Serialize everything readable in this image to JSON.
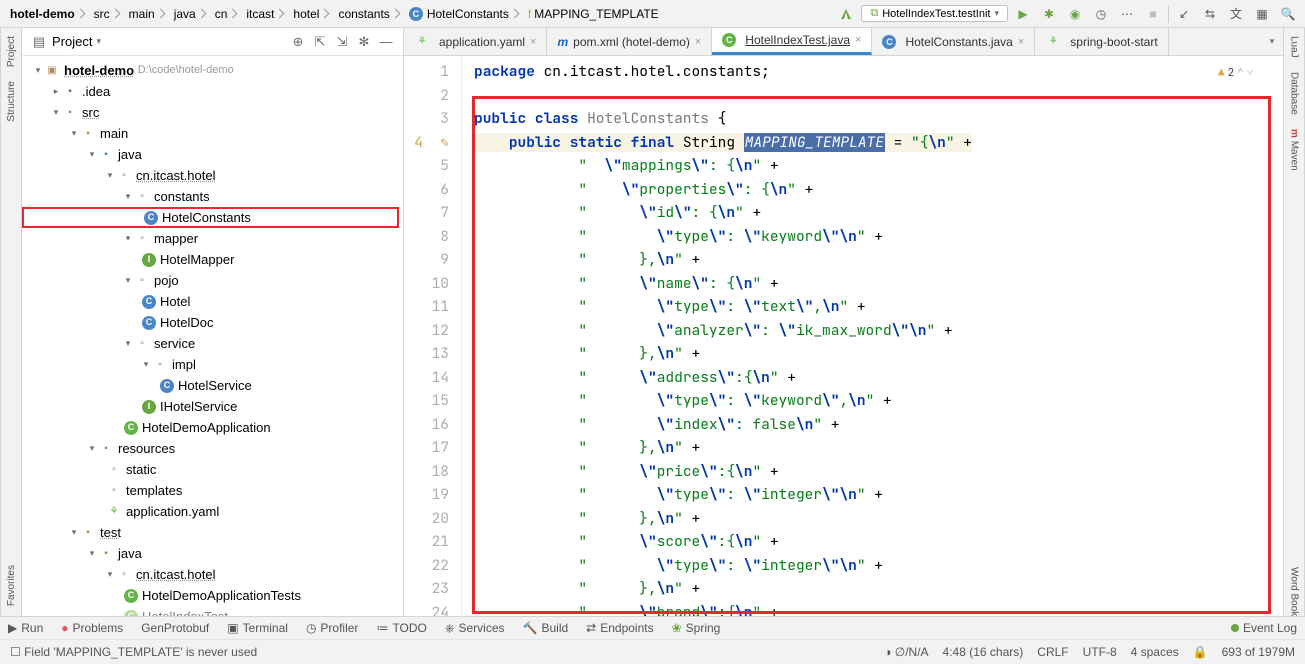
{
  "breadcrumb": [
    "hotel-demo",
    "src",
    "main",
    "java",
    "cn",
    "itcast",
    "hotel",
    "constants",
    "HotelConstants",
    "MAPPING_TEMPLATE"
  ],
  "run_config": "HotelIndexTest.testInit",
  "project_label": "Project",
  "project_root": {
    "name": "hotel-demo",
    "path": "D:\\code\\hotel-demo"
  },
  "tree": {
    "idea": ".idea",
    "src": "src",
    "main": "main",
    "java": "java",
    "pkg_root": "cn.itcast.hotel",
    "constants": "constants",
    "HotelConstants": "HotelConstants",
    "mapper": "mapper",
    "HotelMapper": "HotelMapper",
    "pojo": "pojo",
    "Hotel": "Hotel",
    "HotelDoc": "HotelDoc",
    "service": "service",
    "impl": "impl",
    "HotelService": "HotelService",
    "IHotelService": "IHotelService",
    "HotelDemoApplication": "HotelDemoApplication",
    "resources": "resources",
    "static": "static",
    "templates": "templates",
    "app_yaml": "application.yaml",
    "test": "test",
    "test_java": "java",
    "test_pkg": "cn.itcast.hotel",
    "test_class": "HotelDemoApplicationTests",
    "test_cut": "HotelIndexTest"
  },
  "tabs": [
    {
      "label": "application.yaml",
      "active": false
    },
    {
      "label": "pom.xml (hotel-demo)",
      "active": false
    },
    {
      "label": "HotelIndexTest.java",
      "active": true
    },
    {
      "label": "HotelConstants.java",
      "active": false
    },
    {
      "label": "spring-boot-start",
      "active": false
    }
  ],
  "warning": {
    "count": "2"
  },
  "code": {
    "pkg": "package",
    "pkg_path": " cn.itcast.hotel.constants;",
    "public": "public",
    "class": "class",
    "static": "static",
    "final": "final",
    "clsname": "HotelConstants",
    "brace_open": " {",
    "String": " String ",
    "field": "MAPPING_TEMPLATE",
    "eq": " = ",
    "line3_s": "\"{\\n\"",
    "plus": " +",
    "s2": "\"  \\\"mappings\\\": {\\n\"",
    "s3": "\"    \\\"properties\\\": {\\n\"",
    "s4": "\"      \\\"id\\\": {\\n\"",
    "s5": "\"        \\\"type\\\": \\\"keyword\\\"\\n\"",
    "s6": "\"      },\\n\"",
    "s7": "\"      \\\"name\\\": {\\n\"",
    "s8": "\"        \\\"type\\\": \\\"text\\\",\\n\"",
    "s9": "\"        \\\"analyzer\\\": \\\"ik_max_word\\\"\\n\"",
    "s10": "\"      },\\n\"",
    "s11": "\"      \\\"address\\\":{\\n\"",
    "s12": "\"        \\\"type\\\": \\\"keyword\\\",\\n\"",
    "s13": "\"        \\\"index\\\": false\\n\"",
    "s14": "\"      },\\n\"",
    "s15": "\"      \\\"price\\\":{\\n\"",
    "s16": "\"        \\\"type\\\": \\\"integer\\\"\\n\"",
    "s17": "\"      },\\n\"",
    "s18": "\"      \\\"score\\\":{\\n\"",
    "s19": "\"        \\\"type\\\": \\\"integer\\\"\\n\"",
    "s20": "\"      },\\n\"",
    "s21": "\"      \\\"brand\\\":{\\n\""
  },
  "bottom_tabs": [
    "Run",
    "Problems",
    "GenProtobuf",
    "Terminal",
    "Profiler",
    "TODO",
    "Services",
    "Build",
    "Endpoints",
    "Spring"
  ],
  "event_log": "Event Log",
  "status": {
    "hint": "Field 'MAPPING_TEMPLATE' is never used",
    "pos": "4:48",
    "sel": "(16 chars)",
    "le": "CRLF",
    "enc": "UTF-8",
    "indent": "4 spaces",
    "mem": "693 of 1979M",
    "na": "∅/N/A"
  },
  "side": {
    "project": "Project",
    "structure": "Structure",
    "favorites": "Favorites",
    "lua": "LuaJ",
    "database": "Database",
    "maven": "Maven",
    "wordbook": "Word Book"
  }
}
